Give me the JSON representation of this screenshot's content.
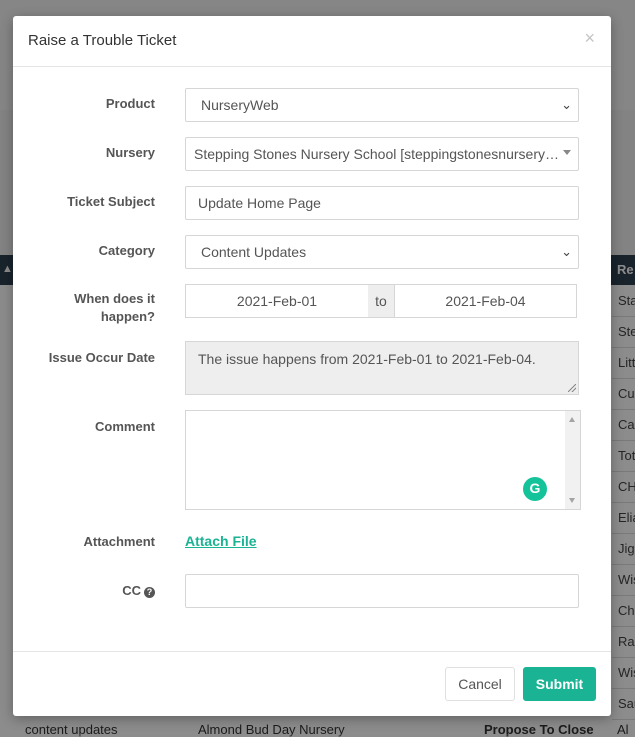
{
  "background": {
    "table_header_col": "Re",
    "rows": [
      "Sta",
      "Ste",
      "Litt",
      "Cu",
      "Cas",
      "Tot",
      "CH",
      "Elia",
      "Jigs",
      "Wis",
      "Che",
      "Rai",
      "Wis",
      "Sau"
    ],
    "bottom_cells": [
      "content updates",
      "Almond Bud Day Nursery",
      "Propose To Close",
      "Al"
    ]
  },
  "modal": {
    "title": "Raise a Trouble Ticket",
    "close_glyph": "×"
  },
  "form": {
    "product": {
      "label": "Product",
      "value": "NurseryWeb"
    },
    "nursery": {
      "label": "Nursery",
      "value": "Stepping Stones Nursery School [steppingstonesnurseryschool]"
    },
    "subject": {
      "label": "Ticket Subject",
      "value": "Update Home Page"
    },
    "category": {
      "label": "Category",
      "value": "Content Updates"
    },
    "when": {
      "label_line1": "When does it",
      "label_line2": "happen?",
      "from": "2021-Feb-01",
      "to_word": "to",
      "to": "2021-Feb-04"
    },
    "occur": {
      "label": "Issue Occur Date",
      "value": "The issue happens from 2021-Feb-01 to 2021-Feb-04."
    },
    "comment": {
      "label": "Comment",
      "value": "",
      "grammarly_glyph": "G"
    },
    "attachment": {
      "label": "Attachment",
      "link": "Attach File"
    },
    "cc": {
      "label": "CC",
      "help_glyph": "?",
      "value": ""
    }
  },
  "footer": {
    "cancel": "Cancel",
    "submit": "Submit"
  },
  "colors": {
    "accent": "#1ab394",
    "table_header": "#2f4050",
    "grammarly": "#15c39a"
  }
}
